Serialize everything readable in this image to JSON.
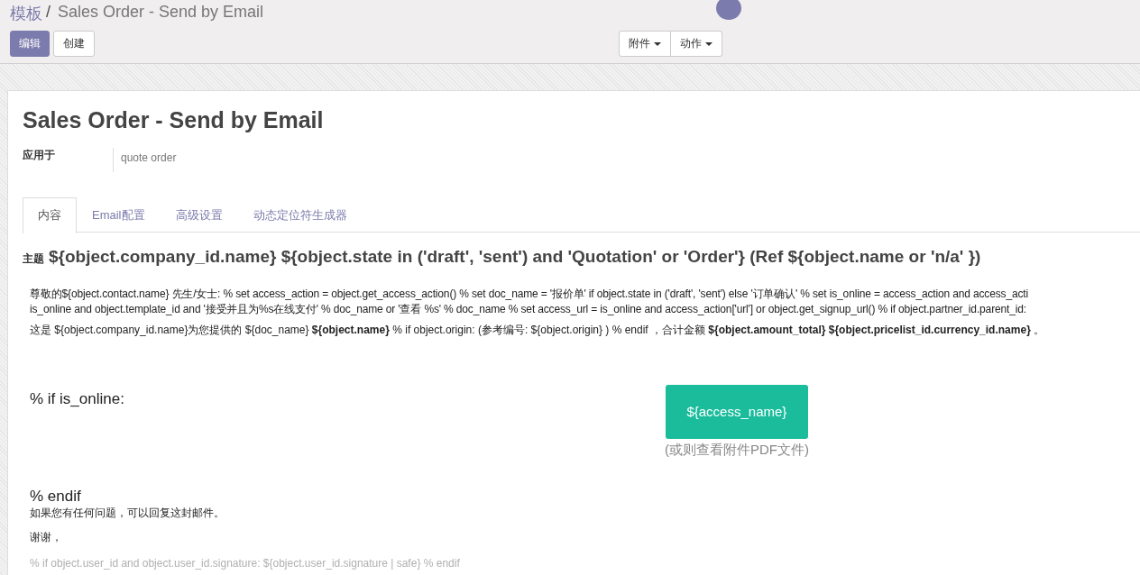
{
  "breadcrumb": {
    "parent": "模板",
    "separator": "/",
    "current": "Sales Order - Send by Email"
  },
  "buttons": [
    {
      "label": "编辑",
      "kind": "primary"
    },
    {
      "label": "创建",
      "kind": "default"
    }
  ],
  "dropdowns": [
    {
      "label": "附件"
    },
    {
      "label": "动作"
    }
  ],
  "form": {
    "title": "Sales Order - Send by Email",
    "field_label": "应用于",
    "field_value": "quote order"
  },
  "tabs": [
    {
      "label": "内容",
      "selected": true
    },
    {
      "label": "Email配置",
      "selected": false
    },
    {
      "label": "高级设置",
      "selected": false
    },
    {
      "label": "动态定位符生成器",
      "selected": false
    }
  ],
  "subject": {
    "label": "主题",
    "value": "${object.company_id.name} ${object.state in ('draft', 'sent') and 'Quotation' or 'Order'} (Ref ${object.name or 'n/a' })"
  },
  "body": {
    "lines": [
      "尊敬的${object.contact.name} 先生/女士: % set access_action = object.get_access_action() % set doc_name = '报价单' if object.state in ('draft', 'sent') else '订单确认' % set is_online = access_action and access_acti",
      "is_online and object.template_id and '接受并且为%s在线支付' % doc_name or '查看 %s' % doc_name % set access_url = is_online and access_action['url'] or object.get_signup_url() % if object.partner_id.parent_id:"
    ],
    "intro": "这是 ${object.company_id.name}为您提供的 ${doc_name} **${object.name}** % if object.origin: (参考编号: ${object.origin} ) % endif ，合计金额 **${object.amount_total} ${object.pricelist_id.currency_id.name}** 。",
    "if_line": "% if is_online:",
    "action_button": "${access_name}",
    "action_note": "(或则查看附件PDF文件)",
    "endif_line": "% endif",
    "question": "如果您有任何问题，可以回复这封邮件。",
    "thanks": "谢谢，",
    "signature": "% if object.user_id and object.user_id.signature: ${object.user_id.signature | safe} % endif"
  }
}
